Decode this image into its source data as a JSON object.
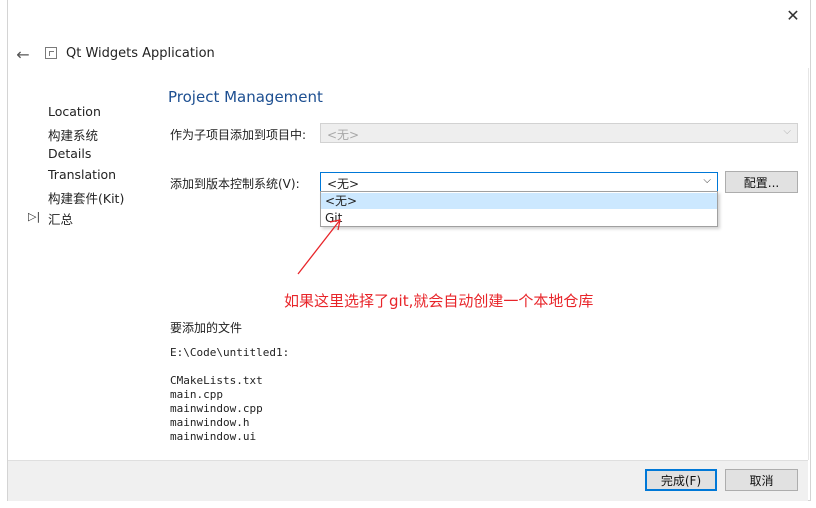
{
  "window": {
    "title": "Qt Widgets Application"
  },
  "icons": {
    "close": "✕",
    "back": "←",
    "chevron": "⌵",
    "nav_marker": "▷|"
  },
  "nav": {
    "items": [
      "Location",
      "构建系统",
      "Details",
      "Translation",
      "构建套件(Kit)",
      "汇总"
    ]
  },
  "page": {
    "title": "Project Management",
    "subproject_label": "作为子项目添加到项目中:",
    "subproject_value": "<无>",
    "vcs_label": "添加到版本控制系统(V):",
    "vcs_value": "<无>",
    "vcs_options": [
      "<无>",
      "Git"
    ],
    "config_button": "配置...",
    "files_label": "要添加的文件",
    "files_path": "E:\\Code\\untitled1:",
    "files": [
      "CMakeLists.txt",
      "main.cpp",
      "mainwindow.cpp",
      "mainwindow.h",
      "mainwindow.ui"
    ]
  },
  "annotation": {
    "text": "如果这里选择了git,就会自动创建一个本地仓库",
    "color": "#e8252a"
  },
  "footer": {
    "finish_button": "完成(F)",
    "cancel_button": "取消"
  }
}
